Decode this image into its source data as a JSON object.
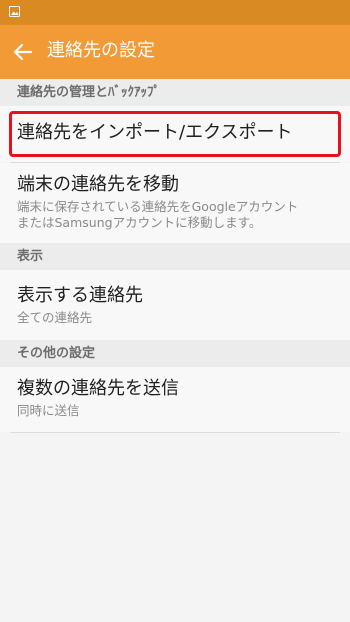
{
  "colors": {
    "status_bar": "#d98a22",
    "app_bar": "#f29a35",
    "highlight": "#e8121c"
  },
  "status_bar": {
    "icons": [
      "gallery-notification-icon"
    ]
  },
  "app_bar": {
    "back_icon": "back-arrow-icon",
    "title": "連絡先の設定"
  },
  "sections": {
    "manage_backup": {
      "header": "連絡先の管理とﾊﾞｯｸｱｯﾌﾟ",
      "import_export": {
        "title": "連絡先をインポート/エクスポート"
      },
      "move": {
        "title": "端末の連絡先を移動",
        "subtitle_line1": "端末に保存されている連絡先をGoogleアカウント",
        "subtitle_line2": "またはSamsungアカウントに移動します。"
      }
    },
    "display": {
      "header": "表示",
      "show_contacts": {
        "title": "表示する連絡先",
        "subtitle": "全ての連絡先"
      }
    },
    "other": {
      "header": "その他の設定",
      "send_multiple": {
        "title": "複数の連絡先を送信",
        "subtitle": "同時に送信"
      }
    }
  }
}
